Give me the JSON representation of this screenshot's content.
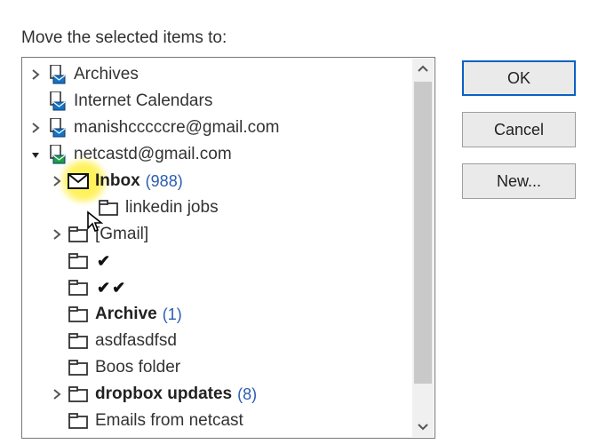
{
  "prompt": "Move the selected items to:",
  "buttons": {
    "ok": "OK",
    "cancel": "Cancel",
    "new": "New..."
  },
  "tree": {
    "items": [
      {
        "label": "Archives",
        "bold": false,
        "count": "",
        "depth": 1,
        "caret": "closed",
        "icon": "store"
      },
      {
        "label": "Internet Calendars",
        "bold": false,
        "count": "",
        "depth": 1,
        "caret": "none",
        "icon": "store"
      },
      {
        "label": "manishcccccre@gmail.com",
        "bold": false,
        "count": "",
        "depth": 1,
        "caret": "closed",
        "icon": "store"
      },
      {
        "label": "netcastd@gmail.com",
        "bold": false,
        "count": "",
        "depth": 1,
        "caret": "open",
        "icon": "store-open"
      },
      {
        "label": "Inbox",
        "bold": true,
        "count": "(988)",
        "depth": 2,
        "caret": "closed",
        "icon": "mail",
        "selected": true
      },
      {
        "label": "linkedin jobs",
        "bold": false,
        "count": "",
        "depth": 3,
        "caret": "none",
        "icon": "folder"
      },
      {
        "label": "[Gmail]",
        "bold": false,
        "count": "",
        "depth": 2,
        "caret": "closed",
        "icon": "folder"
      },
      {
        "label": "",
        "bold": false,
        "count": "",
        "depth": 2,
        "caret": "none",
        "icon": "folder",
        "check": "✔"
      },
      {
        "label": "",
        "bold": false,
        "count": "",
        "depth": 2,
        "caret": "none",
        "icon": "folder",
        "check": "✔✔"
      },
      {
        "label": "Archive",
        "bold": true,
        "count": "(1)",
        "depth": 2,
        "caret": "none",
        "icon": "folder"
      },
      {
        "label": "asdfasdfsd",
        "bold": false,
        "count": "",
        "depth": 2,
        "caret": "none",
        "icon": "folder"
      },
      {
        "label": "Boos folder",
        "bold": false,
        "count": "",
        "depth": 2,
        "caret": "none",
        "icon": "folder"
      },
      {
        "label": "dropbox updates",
        "bold": true,
        "count": "(8)",
        "depth": 2,
        "caret": "closed",
        "icon": "folder"
      },
      {
        "label": "Emails from netcast",
        "bold": false,
        "count": "",
        "depth": 2,
        "caret": "none",
        "icon": "folder"
      }
    ]
  }
}
